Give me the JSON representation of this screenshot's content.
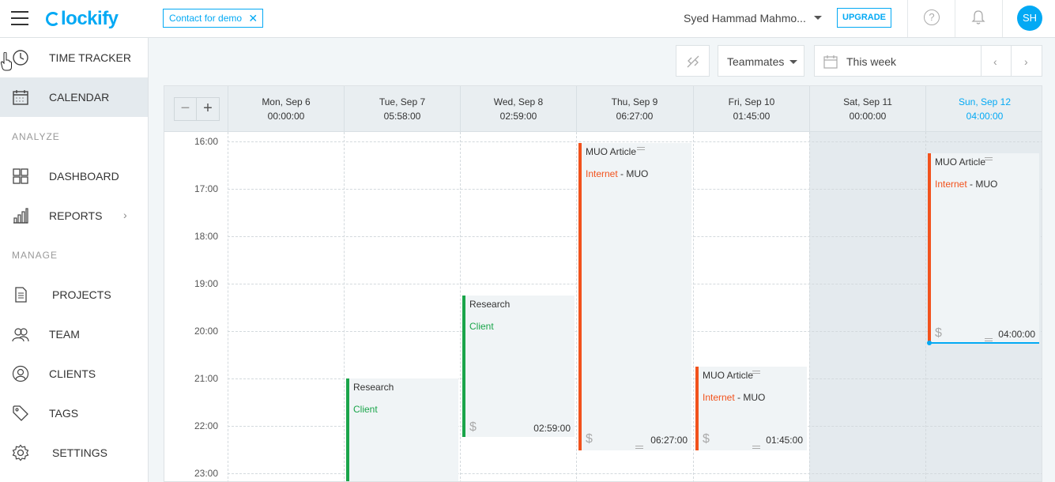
{
  "header": {
    "logo": "lockify",
    "demo_badge": "Contact for demo",
    "demo_close": "✕",
    "user_name": "Syed Hammad Mahmo...",
    "upgrade_label": "UPGRADE",
    "help_label": "?",
    "avatar_initials": "SH",
    "accent_color": "#03a9f4"
  },
  "sidebar": {
    "items": [
      {
        "label": "TIME TRACKER",
        "icon": "clock-icon"
      },
      {
        "label": "CALENDAR",
        "icon": "calendar-icon"
      },
      {
        "label": "DASHBOARD",
        "icon": "dashboard-icon"
      },
      {
        "label": "REPORTS",
        "icon": "reports-icon",
        "chevron": "›"
      },
      {
        "label": "PROJECTS",
        "icon": "projects-icon"
      },
      {
        "label": "TEAM",
        "icon": "team-icon"
      },
      {
        "label": "CLIENTS",
        "icon": "clients-icon"
      },
      {
        "label": "TAGS",
        "icon": "tag-icon"
      },
      {
        "label": "SETTINGS",
        "icon": "gear-icon"
      }
    ],
    "section_analyze": "ANALYZE",
    "section_manage": "MANAGE"
  },
  "toolbar": {
    "teammates_label": "Teammates",
    "range_label": "This week",
    "prev_label": "‹",
    "next_label": "›"
  },
  "calendar": {
    "zoom_out": "−",
    "zoom_in": "+",
    "days": [
      {
        "date": "Mon, Sep 6",
        "total": "00:00:00"
      },
      {
        "date": "Tue, Sep 7",
        "total": "05:58:00"
      },
      {
        "date": "Wed, Sep 8",
        "total": "02:59:00"
      },
      {
        "date": "Thu, Sep 9",
        "total": "06:27:00"
      },
      {
        "date": "Fri, Sep 10",
        "total": "01:45:00"
      },
      {
        "date": "Sat, Sep 11",
        "total": "00:00:00"
      },
      {
        "date": "Sun, Sep 12",
        "total": "04:00:00"
      }
    ],
    "hours": [
      "16:00",
      "17:00",
      "18:00",
      "19:00",
      "20:00",
      "21:00",
      "22:00",
      "23:00"
    ],
    "entries": [
      {
        "title": "Research",
        "project": "Client",
        "client": "",
        "duration": ""
      },
      {
        "title": "Research",
        "project": "Client",
        "client": "",
        "duration": "02:59:00"
      },
      {
        "title": "MUO Article",
        "project": "Internet",
        "client": " - MUO",
        "duration": "06:27:00"
      },
      {
        "title": "MUO Article",
        "project": "Internet",
        "client": " - MUO",
        "duration": "01:45:00"
      },
      {
        "title": "MUO Article",
        "project": "Internet",
        "client": " - MUO",
        "duration": "04:00:00"
      }
    ],
    "dollar_symbol": "$",
    "colors": {
      "green": "#1aa54a",
      "orange": "#f2521c",
      "today": "#03a9f4"
    }
  }
}
